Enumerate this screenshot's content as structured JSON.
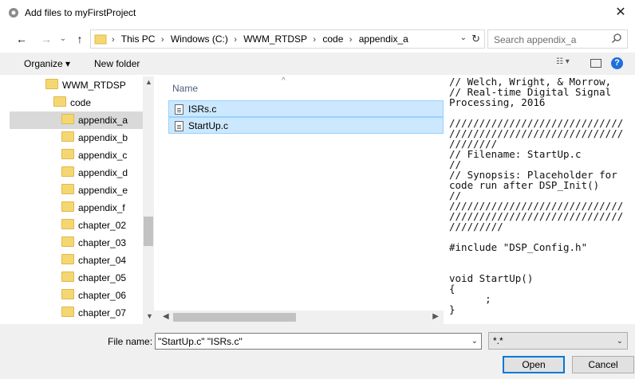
{
  "window": {
    "title": "Add files to myFirstProject",
    "close_glyph": "✕"
  },
  "nav": {
    "back": "←",
    "forward": "→",
    "up": "↑",
    "chevron": "›"
  },
  "address": {
    "crumbs": [
      "This PC",
      "Windows (C:)",
      "WWM_RTDSP",
      "code",
      "appendix_a"
    ],
    "dropdown": "⌄",
    "refresh": "↻"
  },
  "search": {
    "placeholder": "Search appendix_a"
  },
  "toolbar": {
    "organize_label": "Organize ▾",
    "new_folder_label": "New folder",
    "help": "?"
  },
  "tree": {
    "items": [
      {
        "label": "WWM_RTDSP",
        "level": 0,
        "selected": false
      },
      {
        "label": "code",
        "level": 1,
        "selected": false
      },
      {
        "label": "appendix_a",
        "level": 2,
        "selected": true
      },
      {
        "label": "appendix_b",
        "level": 2,
        "selected": false
      },
      {
        "label": "appendix_c",
        "level": 2,
        "selected": false
      },
      {
        "label": "appendix_d",
        "level": 2,
        "selected": false
      },
      {
        "label": "appendix_e",
        "level": 2,
        "selected": false
      },
      {
        "label": "appendix_f",
        "level": 2,
        "selected": false
      },
      {
        "label": "chapter_02",
        "level": 2,
        "selected": false
      },
      {
        "label": "chapter_03",
        "level": 2,
        "selected": false
      },
      {
        "label": "chapter_04",
        "level": 2,
        "selected": false
      },
      {
        "label": "chapter_05",
        "level": 2,
        "selected": false
      },
      {
        "label": "chapter_06",
        "level": 2,
        "selected": false
      },
      {
        "label": "chapter_07",
        "level": 2,
        "selected": false
      }
    ]
  },
  "file_list": {
    "column_name": "Name",
    "files": [
      {
        "name": "ISRs.c"
      },
      {
        "name": "StartUp.c"
      }
    ]
  },
  "preview": {
    "lines": [
      "// Welch, Wright, & Morrow,",
      "// Real-time Digital Signal",
      "Processing, 2016",
      "",
      "/////////////////////////////",
      "/////////////////////////////",
      "////////",
      "// Filename: StartUp.c",
      "//",
      "// Synopsis: Placeholder for",
      "code run after DSP_Init()",
      "//",
      "/////////////////////////////",
      "/////////////////////////////",
      "/////////",
      "",
      "#include \"DSP_Config.h\"",
      "",
      "",
      "void StartUp()",
      "{",
      "      ;",
      "}"
    ]
  },
  "bottom": {
    "file_name_label": "File name:",
    "file_name_value": "\"StartUp.c\" \"ISRs.c\"",
    "filter_value": "*.*",
    "open_label": "Open",
    "cancel_label": "Cancel"
  },
  "colors": {
    "accent": "#0078d7",
    "selection": "#cce8ff",
    "folder": "#f5d772"
  }
}
